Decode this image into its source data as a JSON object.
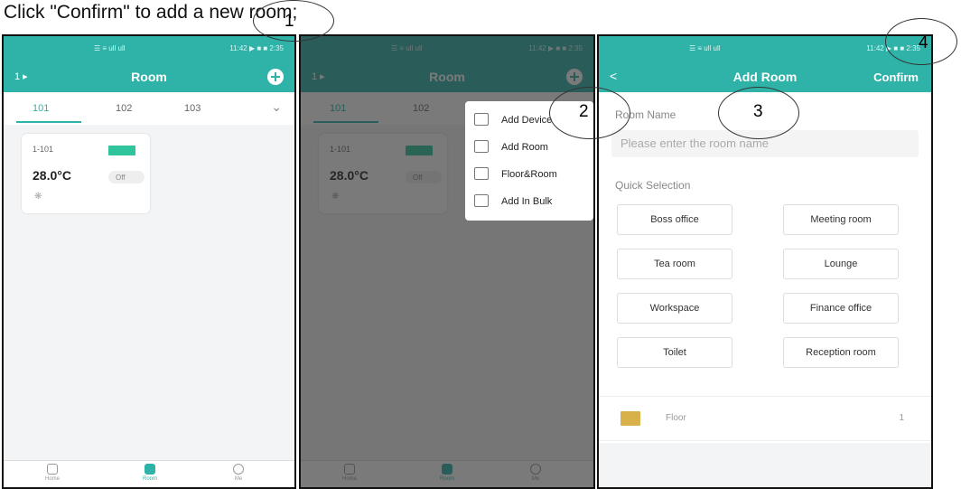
{
  "caption": "Click \"Confirm\" to add a new room;",
  "status": {
    "signal": "☰ ≡ ull ull",
    "time": "11:42 ▶ ■ ■ 2:35"
  },
  "screen1": {
    "left_label": "1  ▸",
    "title": "Room",
    "tabs": [
      "101",
      "102",
      "103"
    ],
    "device": {
      "name": "1-101",
      "temperature": "28.0°C",
      "power": "Off"
    },
    "nav": [
      "Home",
      "Room",
      "Me"
    ]
  },
  "menu": {
    "items": [
      "Add Device",
      "Add Room",
      "Floor&Room",
      "Add In Bulk"
    ]
  },
  "screen3": {
    "back": "<",
    "title": "Add Room",
    "confirm": "Confirm",
    "room_name_label": "Room Name",
    "room_name_placeholder": "Please enter the room name",
    "quick_selection_label": "Quick Selection",
    "quick": [
      "Boss office",
      "Meeting room",
      "Tea room",
      "Lounge",
      "Workspace",
      "Finance office",
      "Toilet",
      "Reception room"
    ],
    "floor_label": "Floor",
    "floor_value": "1"
  },
  "callouts": [
    "1",
    "2",
    "3",
    "4"
  ],
  "colors": {
    "accent": "#2fb3a8",
    "ac_unit": "#2fc49b"
  }
}
